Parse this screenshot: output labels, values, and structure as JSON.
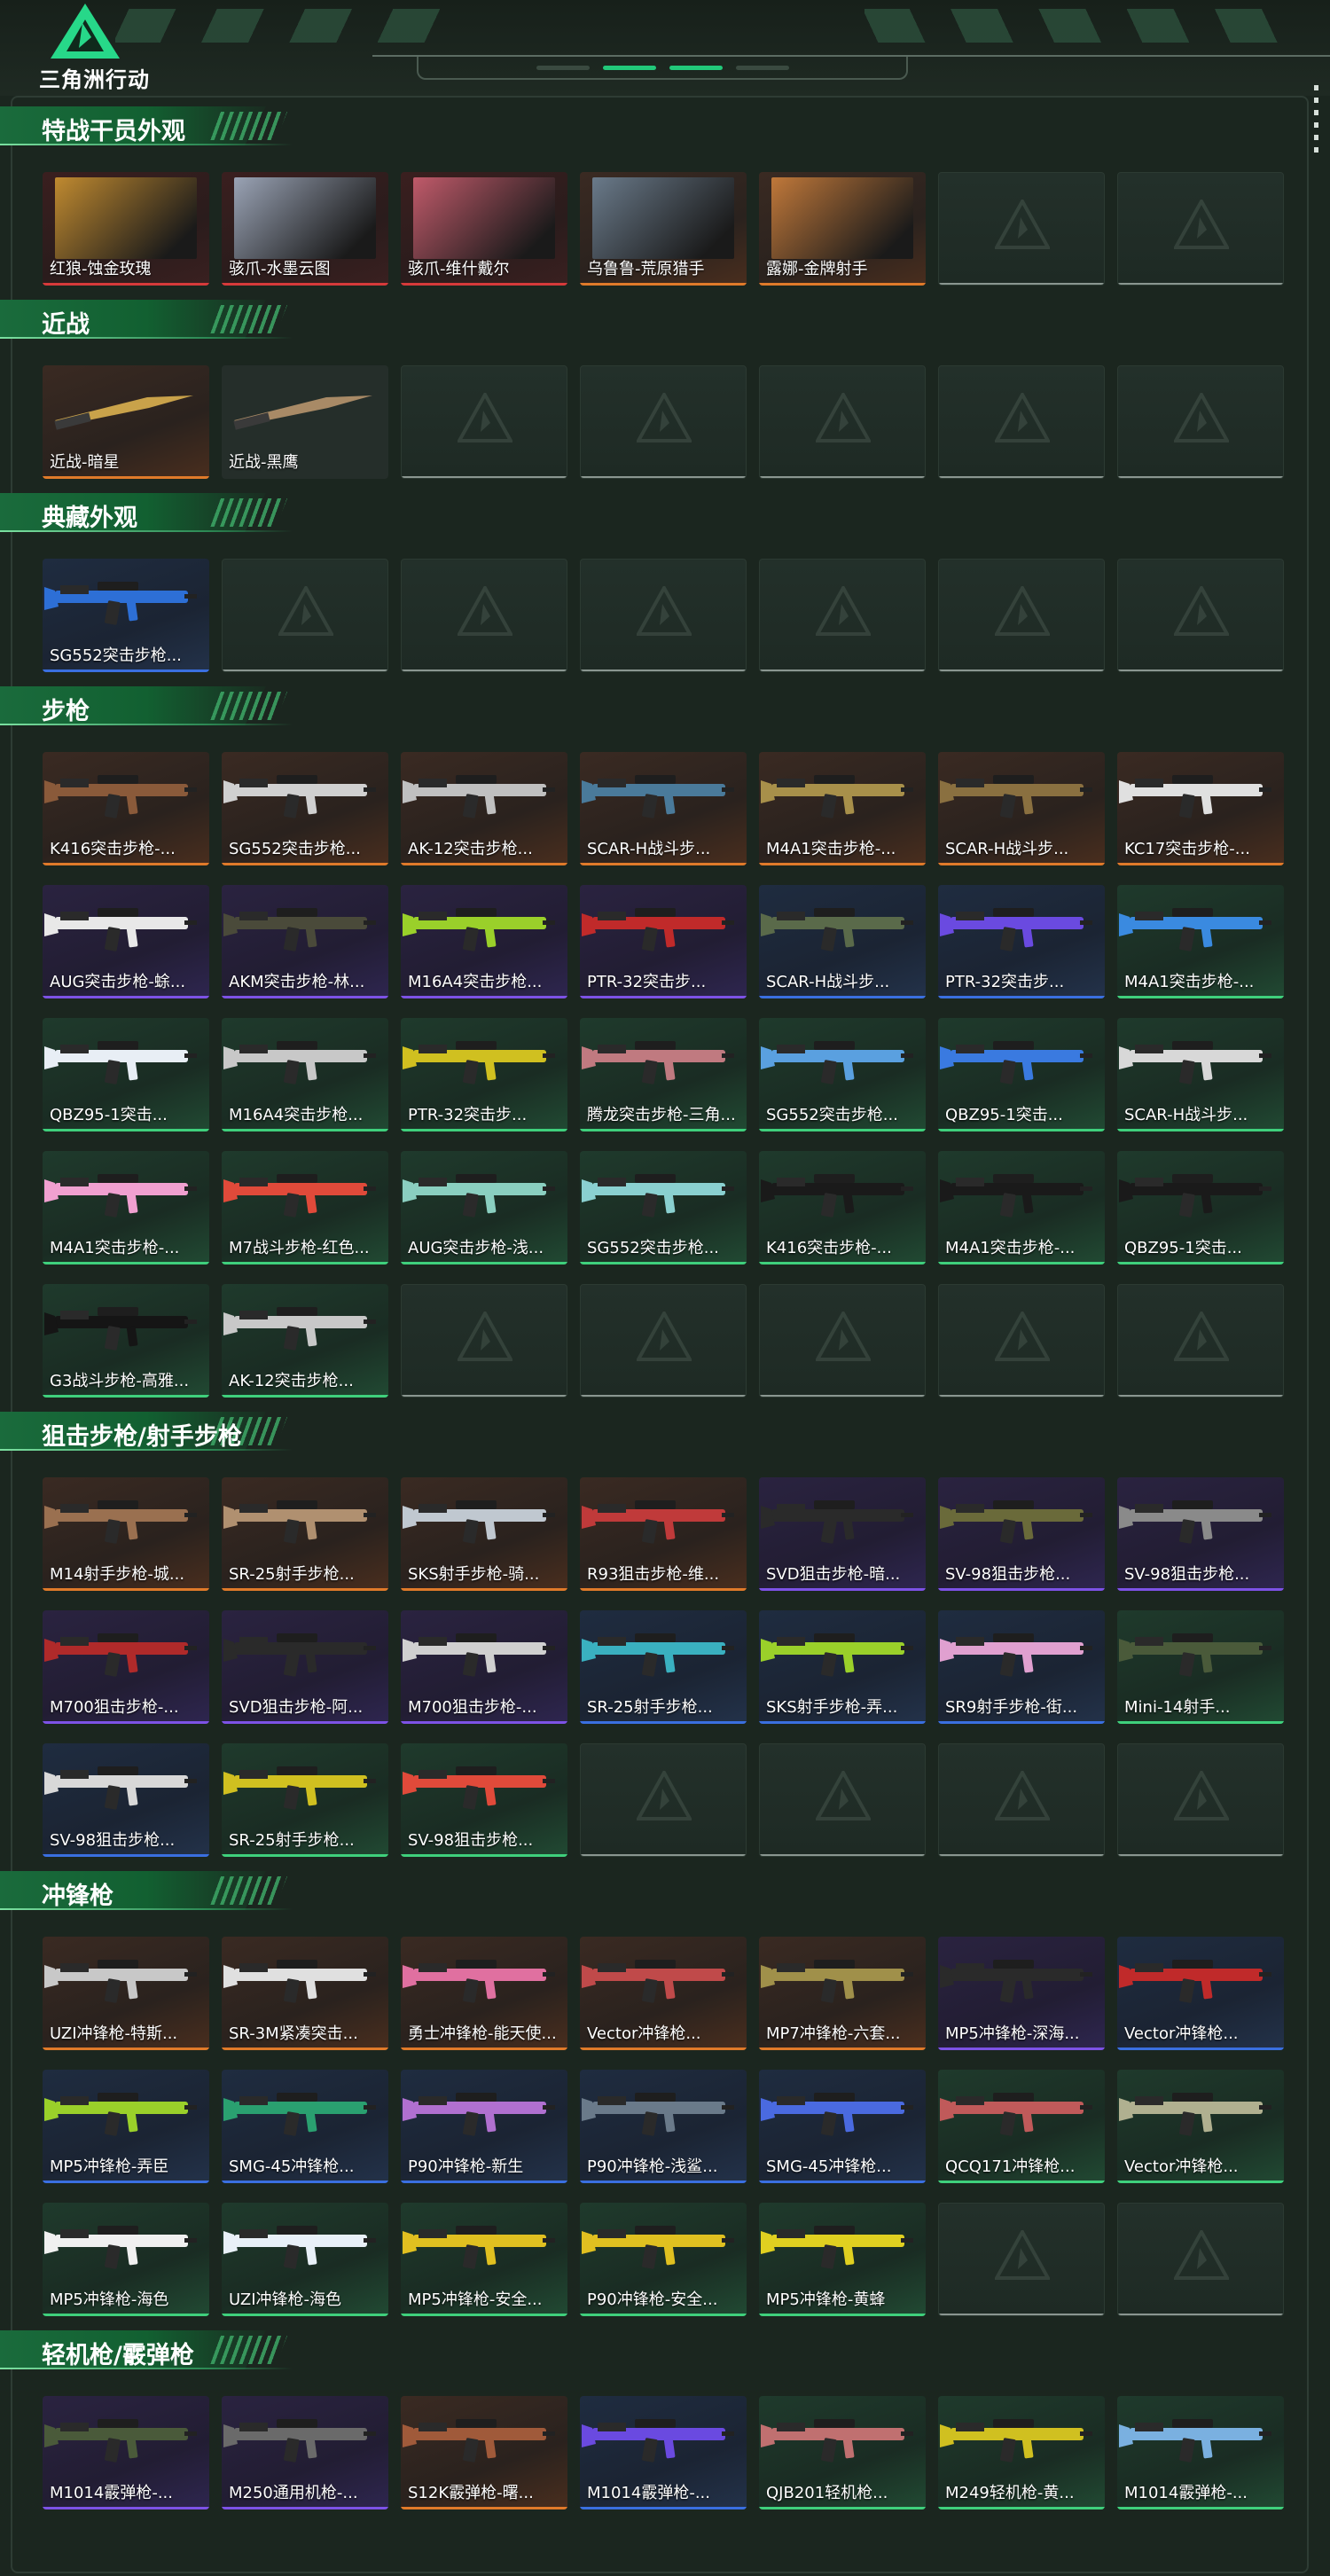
{
  "header": {
    "brand": "三角洲行动"
  },
  "sections": [
    {
      "title": "特战干员外观",
      "cards": [
        {
          "label": "红狼-蚀金玫瑰",
          "rarity": "red",
          "art": "portrait",
          "color": "#c08a30"
        },
        {
          "label": "骇爪-水墨云图",
          "rarity": "red",
          "art": "portrait",
          "color": "#9aa3b5"
        },
        {
          "label": "骇爪-维什戴尔",
          "rarity": "red",
          "art": "portrait",
          "color": "#c05a6a"
        },
        {
          "label": "乌鲁鲁-荒原猎手",
          "rarity": "orange",
          "art": "portrait",
          "color": "#6a7a8a"
        },
        {
          "label": "露娜-金牌射手",
          "rarity": "orange",
          "art": "portrait",
          "color": "#c0783a"
        },
        {
          "label": "",
          "rarity": "empty"
        },
        {
          "label": "",
          "rarity": "empty"
        }
      ]
    },
    {
      "title": "近战",
      "cards": [
        {
          "label": "近战-暗星",
          "rarity": "orange",
          "art": "knife",
          "color": "#c9a24a"
        },
        {
          "label": "近战-黑鹰",
          "rarity": "sq",
          "art": "knife",
          "color": "#a88a66"
        },
        {
          "label": "",
          "rarity": "empty"
        },
        {
          "label": "",
          "rarity": "empty"
        },
        {
          "label": "",
          "rarity": "empty"
        },
        {
          "label": "",
          "rarity": "empty"
        },
        {
          "label": "",
          "rarity": "empty"
        }
      ]
    },
    {
      "title": "典藏外观",
      "cards": [
        {
          "label": "SG552突击步枪...",
          "rarity": "blue",
          "art": "gun",
          "color": "#2d6fd6"
        },
        {
          "label": "",
          "rarity": "empty"
        },
        {
          "label": "",
          "rarity": "empty"
        },
        {
          "label": "",
          "rarity": "empty"
        },
        {
          "label": "",
          "rarity": "empty"
        },
        {
          "label": "",
          "rarity": "empty"
        },
        {
          "label": "",
          "rarity": "empty"
        }
      ]
    },
    {
      "title": "步枪",
      "cards": [
        {
          "label": "K416突击步枪-...",
          "rarity": "orange",
          "art": "gun",
          "color": "#8a5a3a"
        },
        {
          "label": "SG552突击步枪...",
          "rarity": "orange",
          "art": "gun",
          "color": "#d0d0d0"
        },
        {
          "label": "AK-12突击步枪...",
          "rarity": "orange",
          "art": "gun",
          "color": "#c0c0c0"
        },
        {
          "label": "SCAR-H战斗步...",
          "rarity": "orange",
          "art": "gun",
          "color": "#4a7a9a"
        },
        {
          "label": "M4A1突击步枪-...",
          "rarity": "orange",
          "art": "gun",
          "color": "#a8904a"
        },
        {
          "label": "SCAR-H战斗步...",
          "rarity": "orange",
          "art": "gun",
          "color": "#8a7040"
        },
        {
          "label": "KC17突击步枪-...",
          "rarity": "orange",
          "art": "gun",
          "color": "#e0e0e0"
        },
        {
          "label": "AUG突击步枪-蜍...",
          "rarity": "purple",
          "art": "gun",
          "color": "#e8e8e8"
        },
        {
          "label": "AKM突击步枪-林...",
          "rarity": "purple",
          "art": "gun",
          "color": "#4a4a3a"
        },
        {
          "label": "M16A4突击步枪...",
          "rarity": "purple",
          "art": "gun",
          "color": "#9ad02a"
        },
        {
          "label": "PTR-32突击步...",
          "rarity": "purple",
          "art": "gun",
          "color": "#c02a2a"
        },
        {
          "label": "SCAR-H战斗步...",
          "rarity": "blue",
          "art": "gun",
          "color": "#5a6a4a"
        },
        {
          "label": "PTR-32突击步...",
          "rarity": "blue",
          "art": "gun",
          "color": "#6a4ae0"
        },
        {
          "label": "M4A1突击步枪-...",
          "rarity": "green",
          "art": "gun",
          "color": "#3a8ae0"
        },
        {
          "label": "QBZ95-1突击...",
          "rarity": "green",
          "art": "gun",
          "color": "#e8eef5"
        },
        {
          "label": "M16A4突击步枪...",
          "rarity": "green",
          "art": "gun",
          "color": "#c8c8c8"
        },
        {
          "label": "PTR-32突击步...",
          "rarity": "green",
          "art": "gun",
          "color": "#d0c020"
        },
        {
          "label": "腾龙突击步枪-三角...",
          "rarity": "green",
          "art": "gun",
          "color": "#c07a80"
        },
        {
          "label": "SG552突击步枪...",
          "rarity": "green",
          "art": "gun",
          "color": "#5aa0e0"
        },
        {
          "label": "QBZ95-1突击...",
          "rarity": "green",
          "art": "gun",
          "color": "#3a7ae0"
        },
        {
          "label": "SCAR-H战斗步...",
          "rarity": "green",
          "art": "gun",
          "color": "#d8d8d8"
        },
        {
          "label": "M4A1突击步枪-...",
          "rarity": "green",
          "art": "gun",
          "color": "#f0a0d0"
        },
        {
          "label": "M7战斗步枪-红色...",
          "rarity": "green",
          "art": "gun",
          "color": "#e04a3a"
        },
        {
          "label": "AUG突击步枪-浅...",
          "rarity": "green",
          "art": "gun",
          "color": "#8acfc0"
        },
        {
          "label": "SG552突击步枪...",
          "rarity": "green",
          "art": "gun",
          "color": "#8ad0d0"
        },
        {
          "label": "K416突击步枪-...",
          "rarity": "green",
          "art": "gun",
          "color": "#1a1a1a"
        },
        {
          "label": "M4A1突击步枪-...",
          "rarity": "green",
          "art": "gun",
          "color": "#1a1a1a"
        },
        {
          "label": "QBZ95-1突击...",
          "rarity": "green",
          "art": "gun",
          "color": "#1a1a1a"
        },
        {
          "label": "G3战斗步枪-高雅...",
          "rarity": "green",
          "art": "gun",
          "color": "#151515"
        },
        {
          "label": "AK-12突击步枪...",
          "rarity": "green",
          "art": "gun",
          "color": "#c8c8c8"
        },
        {
          "label": "",
          "rarity": "empty"
        },
        {
          "label": "",
          "rarity": "empty"
        },
        {
          "label": "",
          "rarity": "empty"
        },
        {
          "label": "",
          "rarity": "empty"
        },
        {
          "label": "",
          "rarity": "empty"
        }
      ]
    },
    {
      "title": "狙击步枪/射手步枪",
      "cards": [
        {
          "label": "M14射手步枪-城...",
          "rarity": "orange",
          "art": "gun",
          "color": "#9a7050"
        },
        {
          "label": "SR-25射手步枪...",
          "rarity": "orange",
          "art": "gun",
          "color": "#b09070"
        },
        {
          "label": "SKS射手步枪-骑...",
          "rarity": "orange",
          "art": "gun",
          "color": "#c0c8d0"
        },
        {
          "label": "R93狙击步枪-维...",
          "rarity": "orange",
          "art": "gun",
          "color": "#c03a3a"
        },
        {
          "label": "SVD狙击步枪-暗...",
          "rarity": "purple",
          "art": "gun",
          "color": "#2a2a2a"
        },
        {
          "label": "SV-98狙击步枪...",
          "rarity": "purple",
          "art": "gun",
          "color": "#6a6a3a"
        },
        {
          "label": "SV-98狙击步枪...",
          "rarity": "purple",
          "art": "gun",
          "color": "#8a8a8a"
        },
        {
          "label": "M700狙击步枪-...",
          "rarity": "purple",
          "art": "gun",
          "color": "#b02a2a"
        },
        {
          "label": "SVD狙击步枪-阿...",
          "rarity": "purple",
          "art": "gun",
          "color": "#2a2a2a"
        },
        {
          "label": "M700狙击步枪-...",
          "rarity": "purple",
          "art": "gun",
          "color": "#d0d0d0"
        },
        {
          "label": "SR-25射手步枪...",
          "rarity": "blue",
          "art": "gun",
          "color": "#3ab0c0"
        },
        {
          "label": "SKS射手步枪-弄...",
          "rarity": "blue",
          "art": "gun",
          "color": "#9ad02a"
        },
        {
          "label": "SR9射手步枪-街...",
          "rarity": "blue",
          "art": "gun",
          "color": "#e0a0d0"
        },
        {
          "label": "Mini-14射手...",
          "rarity": "green",
          "art": "gun",
          "color": "#4a5a3a"
        },
        {
          "label": "SV-98狙击步枪...",
          "rarity": "blue",
          "art": "gun",
          "color": "#d8d8d8"
        },
        {
          "label": "SR-25射手步枪...",
          "rarity": "green",
          "art": "gun",
          "color": "#d0c020"
        },
        {
          "label": "SV-98狙击步枪...",
          "rarity": "green",
          "art": "gun",
          "color": "#e04a3a"
        },
        {
          "label": "",
          "rarity": "empty"
        },
        {
          "label": "",
          "rarity": "empty"
        },
        {
          "label": "",
          "rarity": "empty"
        },
        {
          "label": "",
          "rarity": "empty"
        }
      ]
    },
    {
      "title": "冲锋枪",
      "cards": [
        {
          "label": "UZI冲锋枪-特斯...",
          "rarity": "orange",
          "art": "gun",
          "color": "#c8c8c8"
        },
        {
          "label": "SR-3M紧凑突击...",
          "rarity": "orange",
          "art": "gun",
          "color": "#e0e0e0"
        },
        {
          "label": "勇士冲锋枪-能天使...",
          "rarity": "orange",
          "art": "gun",
          "color": "#e070a0"
        },
        {
          "label": "Vector冲锋枪...",
          "rarity": "orange",
          "art": "gun",
          "color": "#c04a4a"
        },
        {
          "label": "MP7冲锋枪-六套...",
          "rarity": "orange",
          "art": "gun",
          "color": "#a0904a"
        },
        {
          "label": "MP5冲锋枪-深海...",
          "rarity": "purple",
          "art": "gun",
          "color": "#2a2a2a"
        },
        {
          "label": "Vector冲锋枪...",
          "rarity": "blue",
          "art": "gun",
          "color": "#c02a2a"
        },
        {
          "label": "MP5冲锋枪-弄臣",
          "rarity": "blue",
          "art": "gun",
          "color": "#9ad02a"
        },
        {
          "label": "SMG-45冲锋枪...",
          "rarity": "blue",
          "art": "gun",
          "color": "#2aa070"
        },
        {
          "label": "P90冲锋枪-新生",
          "rarity": "blue",
          "art": "gun",
          "color": "#b070d0"
        },
        {
          "label": "P90冲锋枪-浅鲨...",
          "rarity": "blue",
          "art": "gun",
          "color": "#6a7a8a"
        },
        {
          "label": "SMG-45冲锋枪...",
          "rarity": "blue",
          "art": "gun",
          "color": "#4a6ae0"
        },
        {
          "label": "QCQ171冲锋枪...",
          "rarity": "green",
          "art": "gun",
          "color": "#c05a5a"
        },
        {
          "label": "Vector冲锋枪...",
          "rarity": "green",
          "art": "gun",
          "color": "#b0b090"
        },
        {
          "label": "MP5冲锋枪-海色",
          "rarity": "green",
          "art": "gun",
          "color": "#f0f0f0"
        },
        {
          "label": "UZI冲锋枪-海色",
          "rarity": "green",
          "art": "gun",
          "color": "#e8f0f8"
        },
        {
          "label": "MP5冲锋枪-安全...",
          "rarity": "green",
          "art": "gun",
          "color": "#e0c020"
        },
        {
          "label": "P90冲锋枪-安全...",
          "rarity": "green",
          "art": "gun",
          "color": "#e0c020"
        },
        {
          "label": "MP5冲锋枪-黄蜂",
          "rarity": "green",
          "art": "gun",
          "color": "#e0d020"
        },
        {
          "label": "",
          "rarity": "empty"
        },
        {
          "label": "",
          "rarity": "empty"
        }
      ]
    },
    {
      "title": "轻机枪/霰弹枪",
      "cards": [
        {
          "label": "M1014霰弹枪-...",
          "rarity": "purple",
          "art": "gun",
          "color": "#4a5a3a"
        },
        {
          "label": "M250通用机枪-...",
          "rarity": "purple",
          "art": "gun",
          "color": "#6a6a6a"
        },
        {
          "label": "S12K霰弹枪-曙...",
          "rarity": "orange",
          "art": "gun",
          "color": "#a05a3a"
        },
        {
          "label": "M1014霰弹枪-...",
          "rarity": "blue",
          "art": "gun",
          "color": "#6a4ae0"
        },
        {
          "label": "QJB201轻机枪...",
          "rarity": "green",
          "art": "gun",
          "color": "#c07070"
        },
        {
          "label": "M249轻机枪-黄...",
          "rarity": "green",
          "art": "gun",
          "color": "#d0c020"
        },
        {
          "label": "M1014霰弹枪-...",
          "rarity": "green",
          "art": "gun",
          "color": "#7ab0e0"
        }
      ]
    }
  ]
}
